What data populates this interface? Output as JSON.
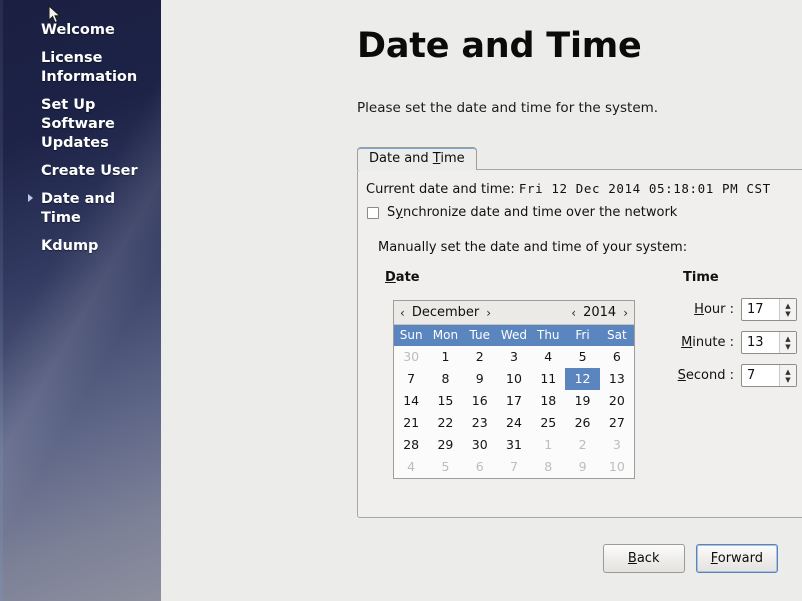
{
  "sidebar": {
    "items": [
      {
        "label": "Welcome",
        "current": false
      },
      {
        "label": "License Information",
        "current": false
      },
      {
        "label": "Set Up Software Updates",
        "current": false
      },
      {
        "label": "Create User",
        "current": false
      },
      {
        "label": "Date and Time",
        "current": true
      },
      {
        "label": "Kdump",
        "current": false
      }
    ],
    "accent_bullet_color": "#b9cbe4"
  },
  "page": {
    "title": "Date and Time",
    "intro": "Please set the date and time for the system."
  },
  "tabs": [
    {
      "label": "Date and Time",
      "active": true
    }
  ],
  "panel": {
    "current_label": "Current date and time: ",
    "current_value": "Fri 12 Dec 2014 05:18:01 PM CST",
    "sync_checkbox_label": "Synchronize date and time over the network",
    "sync_checked": false,
    "manual_label": "Manually set the date and time of your system:"
  },
  "date_section": {
    "heading": "Date",
    "month": "December",
    "year": "2014",
    "prev_month_arrow": "‹",
    "next_month_arrow": "›",
    "prev_year_arrow": "‹",
    "next_year_arrow": "›",
    "weekdays": [
      "Sun",
      "Mon",
      "Tue",
      "Wed",
      "Thu",
      "Fri",
      "Sat"
    ],
    "selected_day": 12,
    "header_bg": "#5a85be",
    "weeks": [
      [
        {
          "d": "30",
          "dim": true
        },
        {
          "d": "1"
        },
        {
          "d": "2"
        },
        {
          "d": "3"
        },
        {
          "d": "4"
        },
        {
          "d": "5"
        },
        {
          "d": "6"
        }
      ],
      [
        {
          "d": "7"
        },
        {
          "d": "8"
        },
        {
          "d": "9"
        },
        {
          "d": "10"
        },
        {
          "d": "11"
        },
        {
          "d": "12",
          "sel": true
        },
        {
          "d": "13"
        }
      ],
      [
        {
          "d": "14"
        },
        {
          "d": "15"
        },
        {
          "d": "16"
        },
        {
          "d": "17"
        },
        {
          "d": "18"
        },
        {
          "d": "19"
        },
        {
          "d": "20"
        }
      ],
      [
        {
          "d": "21"
        },
        {
          "d": "22"
        },
        {
          "d": "23"
        },
        {
          "d": "24"
        },
        {
          "d": "25"
        },
        {
          "d": "26"
        },
        {
          "d": "27"
        }
      ],
      [
        {
          "d": "28"
        },
        {
          "d": "29"
        },
        {
          "d": "30"
        },
        {
          "d": "31"
        },
        {
          "d": "1",
          "dim": true
        },
        {
          "d": "2",
          "dim": true
        },
        {
          "d": "3",
          "dim": true
        }
      ],
      [
        {
          "d": "4",
          "dim": true
        },
        {
          "d": "5",
          "dim": true
        },
        {
          "d": "6",
          "dim": true
        },
        {
          "d": "7",
          "dim": true
        },
        {
          "d": "8",
          "dim": true
        },
        {
          "d": "9",
          "dim": true
        },
        {
          "d": "10",
          "dim": true
        }
      ]
    ]
  },
  "time_section": {
    "heading": "Time",
    "hour_label": "Hour :",
    "hour_value": "17",
    "minute_label": "Minute :",
    "minute_value": "13",
    "second_label": "Second :",
    "second_value": "7",
    "up_arrow": "▲",
    "down_arrow": "▼"
  },
  "footer": {
    "back_label": "Back",
    "forward_label": "Forward",
    "focused": "forward"
  }
}
